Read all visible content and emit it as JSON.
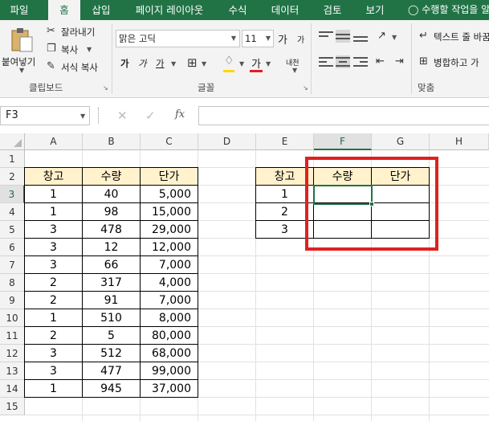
{
  "menu": {
    "tabs": [
      "파일",
      "홈",
      "삽입",
      "페이지 레이아웃",
      "수식",
      "데이터",
      "검토",
      "보기"
    ],
    "active_tab": "홈",
    "tell_me": "수행할 작업을 알"
  },
  "ribbon": {
    "clipboard": {
      "paste": "붙여넣기",
      "cut": "잘라내기",
      "copy": "복사",
      "format_painter": "서식 복사",
      "label": "클립보드"
    },
    "font": {
      "name": "맑은 고딕",
      "size": "11",
      "bold": "가",
      "italic": "가",
      "underline": "가",
      "grow": "가",
      "shrink": "가",
      "color_glyph": "가",
      "phonetic": "내천",
      "label": "글꼴"
    },
    "alignment": {
      "wrap_text": "텍스트 줄 바꿈",
      "merge": "병합하고 가",
      "label": "맞춤"
    }
  },
  "formula_bar": {
    "name_box": "F3",
    "fx": "fx",
    "value": ""
  },
  "sheet": {
    "columns": [
      "A",
      "B",
      "C",
      "D",
      "E",
      "F",
      "G",
      "H"
    ],
    "rows": [
      "1",
      "2",
      "3",
      "4",
      "5",
      "6",
      "7",
      "8",
      "9",
      "10",
      "11",
      "12",
      "13",
      "14",
      "15"
    ],
    "selected_column": "F",
    "selected_row": "3",
    "table1": {
      "headers": [
        "창고",
        "수량",
        "단가"
      ],
      "rows": [
        [
          "1",
          "40",
          "5,000"
        ],
        [
          "1",
          "98",
          "15,000"
        ],
        [
          "3",
          "478",
          "29,000"
        ],
        [
          "3",
          "12",
          "12,000"
        ],
        [
          "3",
          "66",
          "7,000"
        ],
        [
          "2",
          "317",
          "4,000"
        ],
        [
          "2",
          "91",
          "7,000"
        ],
        [
          "1",
          "510",
          "8,000"
        ],
        [
          "2",
          "5",
          "80,000"
        ],
        [
          "3",
          "512",
          "68,000"
        ],
        [
          "3",
          "477",
          "99,000"
        ],
        [
          "1",
          "945",
          "37,000"
        ]
      ]
    },
    "table2": {
      "headers": [
        "창고",
        "수량",
        "단가"
      ],
      "rows": [
        [
          "1",
          "",
          ""
        ],
        [
          "2",
          "",
          ""
        ],
        [
          "3",
          "",
          ""
        ]
      ]
    }
  },
  "colors": {
    "accent": "#217346",
    "header_fill": "#fff2cc",
    "highlight": "#e02020"
  }
}
